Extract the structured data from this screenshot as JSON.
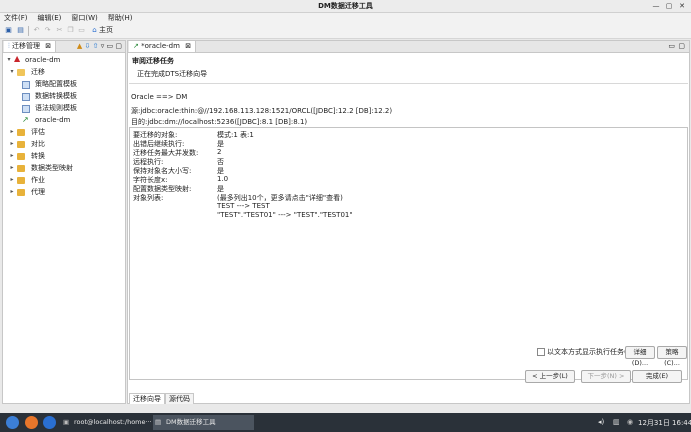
{
  "window": {
    "title": "DM数据迁移工具"
  },
  "menu": [
    "文件(F)",
    "编辑(E)",
    "窗口(W)",
    "帮助(H)"
  ],
  "toolbar": {
    "home_label": "主页"
  },
  "left_panel": {
    "tab_label": "迁移管理",
    "tree": [
      {
        "label": "oracle-dm",
        "level": 0,
        "expanded": true,
        "icon": "project-icon"
      },
      {
        "label": "迁移",
        "level": 1,
        "expanded": true,
        "icon": "folder-open-icon"
      },
      {
        "label": "策略配置模板",
        "level": 2,
        "icon": "template-icon"
      },
      {
        "label": "数据转换模板",
        "level": 2,
        "icon": "template-icon"
      },
      {
        "label": "语法规则模板",
        "level": 2,
        "icon": "template-icon"
      },
      {
        "label": "oracle-dm",
        "level": 2,
        "icon": "migration-icon"
      },
      {
        "label": "评估",
        "level": 1,
        "expanded": false,
        "icon": "folder-icon"
      },
      {
        "label": "对比",
        "level": 1,
        "expanded": false,
        "icon": "folder-icon"
      },
      {
        "label": "转换",
        "level": 1,
        "expanded": false,
        "icon": "folder-icon"
      },
      {
        "label": "数据类型映射",
        "level": 1,
        "expanded": false,
        "icon": "folder-icon"
      },
      {
        "label": "作业",
        "level": 1,
        "expanded": false,
        "icon": "folder-icon"
      },
      {
        "label": "代理",
        "level": 1,
        "expanded": false,
        "icon": "folder-icon"
      }
    ]
  },
  "editor": {
    "tab_label": "*oracle-dm",
    "wizard_title": "审阅迁移任务",
    "wizard_subtitle": "正在完成DTS迁移向导",
    "direction": "Oracle ==> DM",
    "source": "源:jdbc:oracle:thin:@//192.168.113.128:1521/ORCL([JDBC]:12.2 [DB]:12.2)",
    "target": "目的:jdbc:dm://localhost:5236([JDBC]:8.1 [DB]:8.1)",
    "summary": [
      {
        "key": "要迁移的对象:",
        "value": "模式:1 表:1"
      },
      {
        "key": "出错后继续执行:",
        "value": "是"
      },
      {
        "key": "迁移任务最大并发数:",
        "value": "2"
      },
      {
        "key": "远程执行:",
        "value": "否"
      },
      {
        "key": "保持对象名大小写:",
        "value": "是"
      },
      {
        "key": "字符长度x:",
        "value": "1.0"
      },
      {
        "key": "配置数据类型映射:",
        "value": "是"
      },
      {
        "key": "对象列表:",
        "value": "(最多列出10个，更多请点击\"详细\"查看)"
      },
      {
        "key": "",
        "value": "TEST ---> TEST"
      },
      {
        "key": "",
        "value": "\"TEST\".\"TEST01\" ---> \"TEST\".\"TEST01\""
      }
    ],
    "text_mode_label": "以文本方式显示执行任务(E)",
    "details_label": "详细(D)...",
    "strategy_label": "策略(C)...",
    "back_label": "< 上一步(L)",
    "next_label": "下一步(N) >",
    "finish_label": "完成(E)",
    "bottom_tabs": [
      "迁移向导",
      "源代码"
    ]
  },
  "taskbar": {
    "items": [
      {
        "label": "root@localhost:/home···",
        "active": false
      },
      {
        "label": "DM数据迁移工具",
        "active": true
      }
    ],
    "datetime": "12月31日 16:44"
  }
}
